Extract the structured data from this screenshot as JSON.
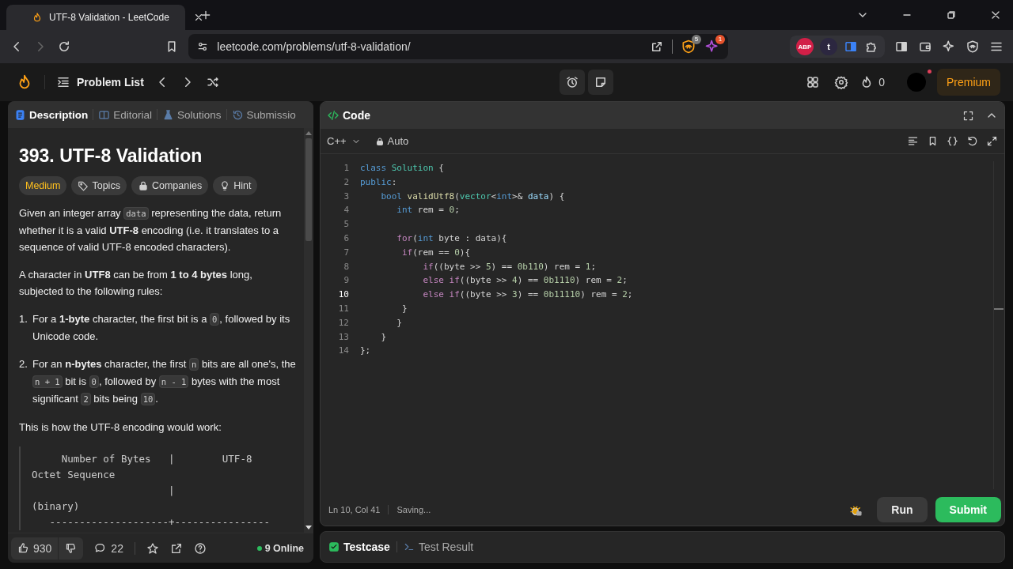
{
  "browser": {
    "tab_title": "UTF-8 Validation - LeetCode",
    "url": "leetcode.com/problems/utf-8-validation/",
    "shield_badge": "5",
    "alert_badge": "1",
    "extensions": [
      "ABP",
      "t"
    ]
  },
  "nav": {
    "problem_list": "Problem List",
    "streak": "0",
    "premium": "Premium"
  },
  "description": {
    "tabs": [
      {
        "label": "Description",
        "selected": true
      },
      {
        "label": "Editorial",
        "selected": false
      },
      {
        "label": "Solutions",
        "selected": false
      },
      {
        "label": "Submissio",
        "selected": false
      }
    ],
    "title": "393. UTF-8 Validation",
    "tags": [
      {
        "label": "Medium",
        "kind": "difficulty"
      },
      {
        "label": "Topics",
        "kind": "topics"
      },
      {
        "label": "Companies",
        "kind": "companies"
      },
      {
        "label": "Hint",
        "kind": "hint"
      }
    ],
    "blocks": [
      {
        "kind": "paragraph",
        "segments": [
          {
            "kind": "text",
            "text": "Given an integer array "
          },
          {
            "kind": "code",
            "text": "data"
          },
          {
            "kind": "text",
            "text": " representing the data, return whether it is a valid **UTF-8** encoding (i.e. it translates to a sequence of valid UTF-8 encoded characters)."
          }
        ]
      },
      {
        "kind": "paragraph",
        "segments": [
          {
            "kind": "text",
            "text": "A character in **UTF8** can be from **1 to 4 bytes** long, subjected to the following rules:"
          }
        ]
      },
      {
        "kind": "list_item",
        "number": "1.",
        "segments": [
          {
            "kind": "text",
            "text": "For a **1-byte** character, the first bit is a "
          },
          {
            "kind": "code",
            "text": "0"
          },
          {
            "kind": "text",
            "text": ", followed by its Unicode code."
          }
        ]
      },
      {
        "kind": "list_item",
        "number": "2.",
        "segments": [
          {
            "kind": "text",
            "text": "For an **n-bytes** character, the first "
          },
          {
            "kind": "code",
            "text": "n"
          },
          {
            "kind": "text",
            "text": " bits are all one's, the "
          },
          {
            "kind": "code",
            "text": "n + 1"
          },
          {
            "kind": "text",
            "text": " bit is "
          },
          {
            "kind": "code",
            "text": "0"
          },
          {
            "kind": "text",
            "text": ", followed by "
          },
          {
            "kind": "code",
            "text": "n - 1"
          },
          {
            "kind": "text",
            "text": " bytes with the most significant "
          },
          {
            "kind": "code",
            "text": "2"
          },
          {
            "kind": "text",
            "text": " bits being "
          },
          {
            "kind": "code",
            "text": "10"
          },
          {
            "kind": "text",
            "text": "."
          }
        ]
      },
      {
        "kind": "paragraph",
        "segments": [
          {
            "kind": "text",
            "text": "This is how the UTF-8 encoding would work:"
          }
        ]
      },
      {
        "kind": "pre",
        "lines": [
          "     Number of Bytes   |        UTF-8",
          "Octet Sequence",
          "                       |",
          "(binary)",
          "   --------------------+----------------"
        ]
      }
    ],
    "footer": {
      "likes": "930",
      "comments": "22",
      "online": "9 Online"
    }
  },
  "editor": {
    "title": "Code",
    "language": "C++",
    "mode": "Auto",
    "lines": [
      {
        "number": "1",
        "selected": false,
        "tokens": [
          {
            "kind": "kw",
            "text": "class "
          },
          {
            "kind": "type",
            "text": "Solution"
          },
          {
            "kind": "p",
            "text": " {"
          }
        ]
      },
      {
        "number": "2",
        "selected": false,
        "tokens": [
          {
            "kind": "kw",
            "text": "public"
          },
          {
            "kind": "p",
            "text": ":"
          }
        ]
      },
      {
        "number": "3",
        "selected": false,
        "tokens": [
          {
            "kind": "kw",
            "text": "    bool "
          },
          {
            "kind": "fn",
            "text": "validUtf8"
          },
          {
            "kind": "p",
            "text": "("
          },
          {
            "kind": "type",
            "text": "vector"
          },
          {
            "kind": "p",
            "text": "<"
          },
          {
            "kind": "kw",
            "text": "int"
          },
          {
            "kind": "p",
            "text": ">& "
          },
          {
            "kind": "var",
            "text": "data"
          },
          {
            "kind": "p",
            "text": ") {"
          }
        ]
      },
      {
        "number": "4",
        "selected": false,
        "tokens": [
          {
            "kind": "kw",
            "text": "       int"
          },
          {
            "kind": "p",
            "text": " rem = "
          },
          {
            "kind": "num",
            "text": "0"
          },
          {
            "kind": "p",
            "text": ";"
          }
        ]
      },
      {
        "number": "5",
        "selected": false
      },
      {
        "number": "6",
        "selected": false,
        "tokens": [
          {
            "kind": "ctl",
            "text": "       for"
          },
          {
            "kind": "p",
            "text": "("
          },
          {
            "kind": "kw",
            "text": "int"
          },
          {
            "kind": "p",
            "text": " byte : data){"
          }
        ]
      },
      {
        "number": "7",
        "selected": false,
        "tokens": [
          {
            "kind": "ctl",
            "text": "        if"
          },
          {
            "kind": "p",
            "text": "(rem == "
          },
          {
            "kind": "num",
            "text": "0"
          },
          {
            "kind": "p",
            "text": "){"
          }
        ]
      },
      {
        "number": "8",
        "selected": false,
        "tokens": [
          {
            "kind": "ctl",
            "text": "            if"
          },
          {
            "kind": "p",
            "text": "((byte >> "
          },
          {
            "kind": "num",
            "text": "5"
          },
          {
            "kind": "p",
            "text": ") == "
          },
          {
            "kind": "num",
            "text": "0b110"
          },
          {
            "kind": "p",
            "text": ") rem = "
          },
          {
            "kind": "num",
            "text": "1"
          },
          {
            "kind": "p",
            "text": ";"
          }
        ]
      },
      {
        "number": "9",
        "selected": false,
        "tokens": [
          {
            "kind": "ctl",
            "text": "            else if"
          },
          {
            "kind": "p",
            "text": "((byte >> "
          },
          {
            "kind": "num",
            "text": "4"
          },
          {
            "kind": "p",
            "text": ") == "
          },
          {
            "kind": "num",
            "text": "0b1110"
          },
          {
            "kind": "p",
            "text": ") rem = "
          },
          {
            "kind": "num",
            "text": "2"
          },
          {
            "kind": "p",
            "text": ";"
          }
        ]
      },
      {
        "number": "10",
        "selected": true,
        "tokens": [
          {
            "kind": "ctl",
            "text": "            else if"
          },
          {
            "kind": "p",
            "text": "((byte >> "
          },
          {
            "kind": "num",
            "text": "3"
          },
          {
            "kind": "p",
            "text": ") == "
          },
          {
            "kind": "num",
            "text": "0b11110"
          },
          {
            "kind": "p",
            "text": ") rem = "
          },
          {
            "kind": "num",
            "text": "2"
          },
          {
            "kind": "p",
            "text": ";"
          }
        ]
      },
      {
        "number": "11",
        "selected": false,
        "tokens": [
          {
            "kind": "p",
            "text": "        }"
          }
        ]
      },
      {
        "number": "12",
        "selected": false,
        "tokens": [
          {
            "kind": "p",
            "text": "       }"
          }
        ]
      },
      {
        "number": "13",
        "selected": false,
        "tokens": [
          {
            "kind": "p",
            "text": "    }"
          }
        ]
      },
      {
        "number": "14",
        "selected": false,
        "tokens": [
          {
            "kind": "p",
            "text": "};"
          }
        ]
      }
    ],
    "cursor_position": "Ln 10, Col 41",
    "save_status": "Saving...",
    "run": "Run",
    "submit": "Submit"
  },
  "bottom_tabs": [
    {
      "label": "Testcase",
      "kind": "testcase",
      "selected": true
    },
    {
      "label": "Test Result",
      "kind": "result",
      "selected": false
    }
  ]
}
